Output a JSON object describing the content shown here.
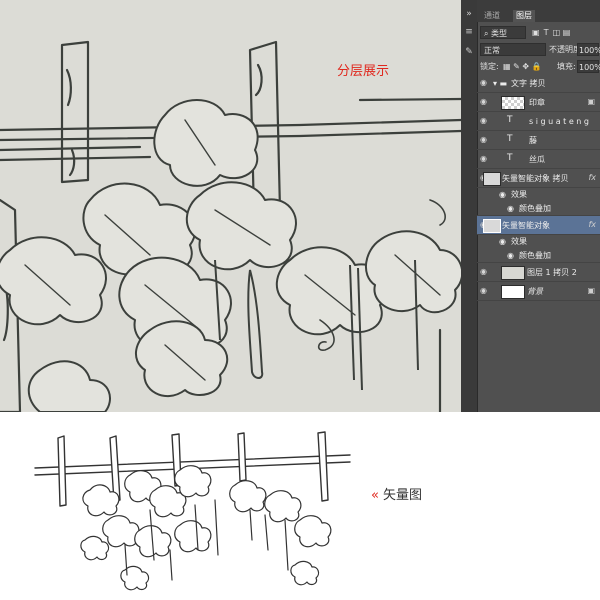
{
  "canvas": {
    "title": "分层展示"
  },
  "layers_panel": {
    "tabs": [
      "通道",
      "图层"
    ],
    "active_tab": 1,
    "kind_filter": "类型",
    "blend_mode": "正常",
    "opacity_label": "不透明度:",
    "opacity_value": "100%",
    "lock_label": "锁定:",
    "fill_label": "填充:",
    "fill_value": "100%",
    "layers": [
      {
        "name": "文字 拷贝",
        "kind": "group"
      },
      {
        "name": "印章",
        "kind": "pixel-checker"
      },
      {
        "name": "s i g u a t e n g",
        "kind": "text"
      },
      {
        "name": "藤",
        "kind": "text"
      },
      {
        "name": "丝瓜",
        "kind": "text"
      },
      {
        "name": "矢量智能对象 拷贝",
        "kind": "smart",
        "fx": "fx"
      },
      {
        "name": "效果",
        "kind": "effect"
      },
      {
        "name": "颜色叠加",
        "kind": "effect-item"
      },
      {
        "name": "矢量智能对象",
        "kind": "smart",
        "fx": "fx",
        "selected": true
      },
      {
        "name": "效果",
        "kind": "effect"
      },
      {
        "name": "颜色叠加",
        "kind": "effect-item"
      },
      {
        "name": "图层 1 拷贝 2",
        "kind": "pixel"
      },
      {
        "name": "背景",
        "kind": "background"
      }
    ]
  },
  "bottom": {
    "label": "矢量图",
    "chevron": "«"
  },
  "colors": {
    "canvas_bg": "#dcdcd6",
    "ink": "#3c403c",
    "accent_red": "#e0281e",
    "panel_bg": "#505050",
    "selected_layer": "#5b7396"
  }
}
